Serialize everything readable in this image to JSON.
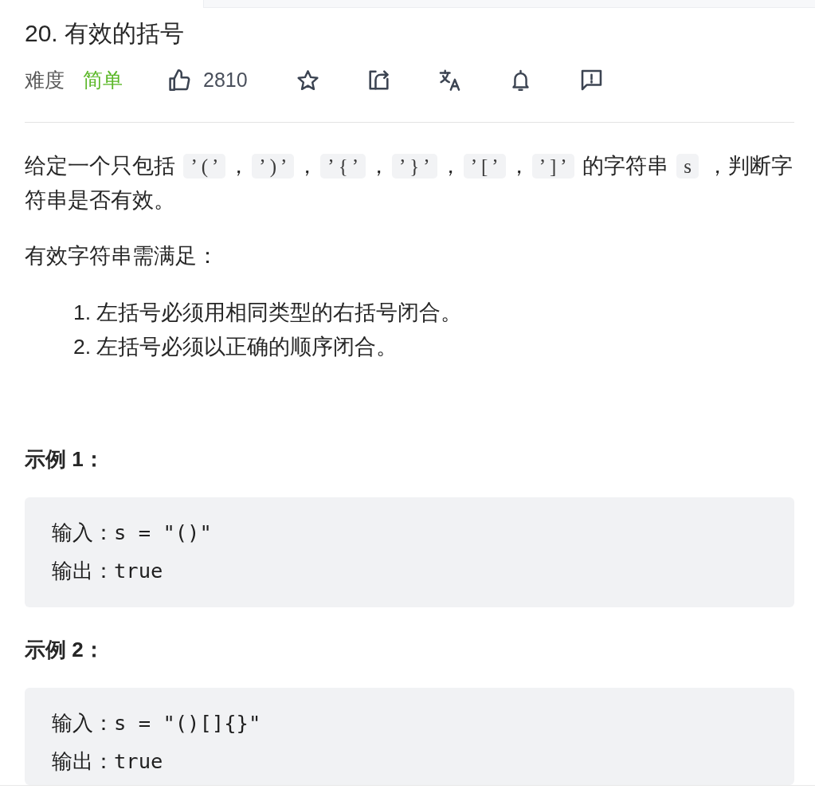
{
  "problem": {
    "title": "20. 有效的括号",
    "difficulty_label": "难度",
    "difficulty": "简单",
    "likes": "2810"
  },
  "description": {
    "segments": [
      {
        "kind": "text",
        "text": "给定一个只包括 "
      },
      {
        "kind": "code",
        "text": "’(’"
      },
      {
        "kind": "text",
        "text": "，"
      },
      {
        "kind": "code",
        "text": "’)’"
      },
      {
        "kind": "text",
        "text": "，"
      },
      {
        "kind": "code",
        "text": "’{’"
      },
      {
        "kind": "text",
        "text": "，"
      },
      {
        "kind": "code",
        "text": "’}’"
      },
      {
        "kind": "text",
        "text": "，"
      },
      {
        "kind": "code",
        "text": "’[’"
      },
      {
        "kind": "text",
        "text": "，"
      },
      {
        "kind": "code",
        "text": "’]’"
      },
      {
        "kind": "text",
        "text": " 的字符串 "
      },
      {
        "kind": "code",
        "text": "s"
      },
      {
        "kind": "text",
        "text": " ，判断字符串是否有效。"
      }
    ],
    "requirements_intro": "有效字符串需满足：",
    "requirements": [
      "1. 左括号必须用相同类型的右括号闭合。",
      "2. 左括号必须以正确的顺序闭合。"
    ]
  },
  "examples": [
    {
      "heading": "示例 1：",
      "lines": [
        "输入：s = \"()\"",
        "输出：true"
      ]
    },
    {
      "heading": "示例 2：",
      "lines": [
        "输入：s = \"()[]{}\"",
        "输出：true"
      ]
    }
  ]
}
